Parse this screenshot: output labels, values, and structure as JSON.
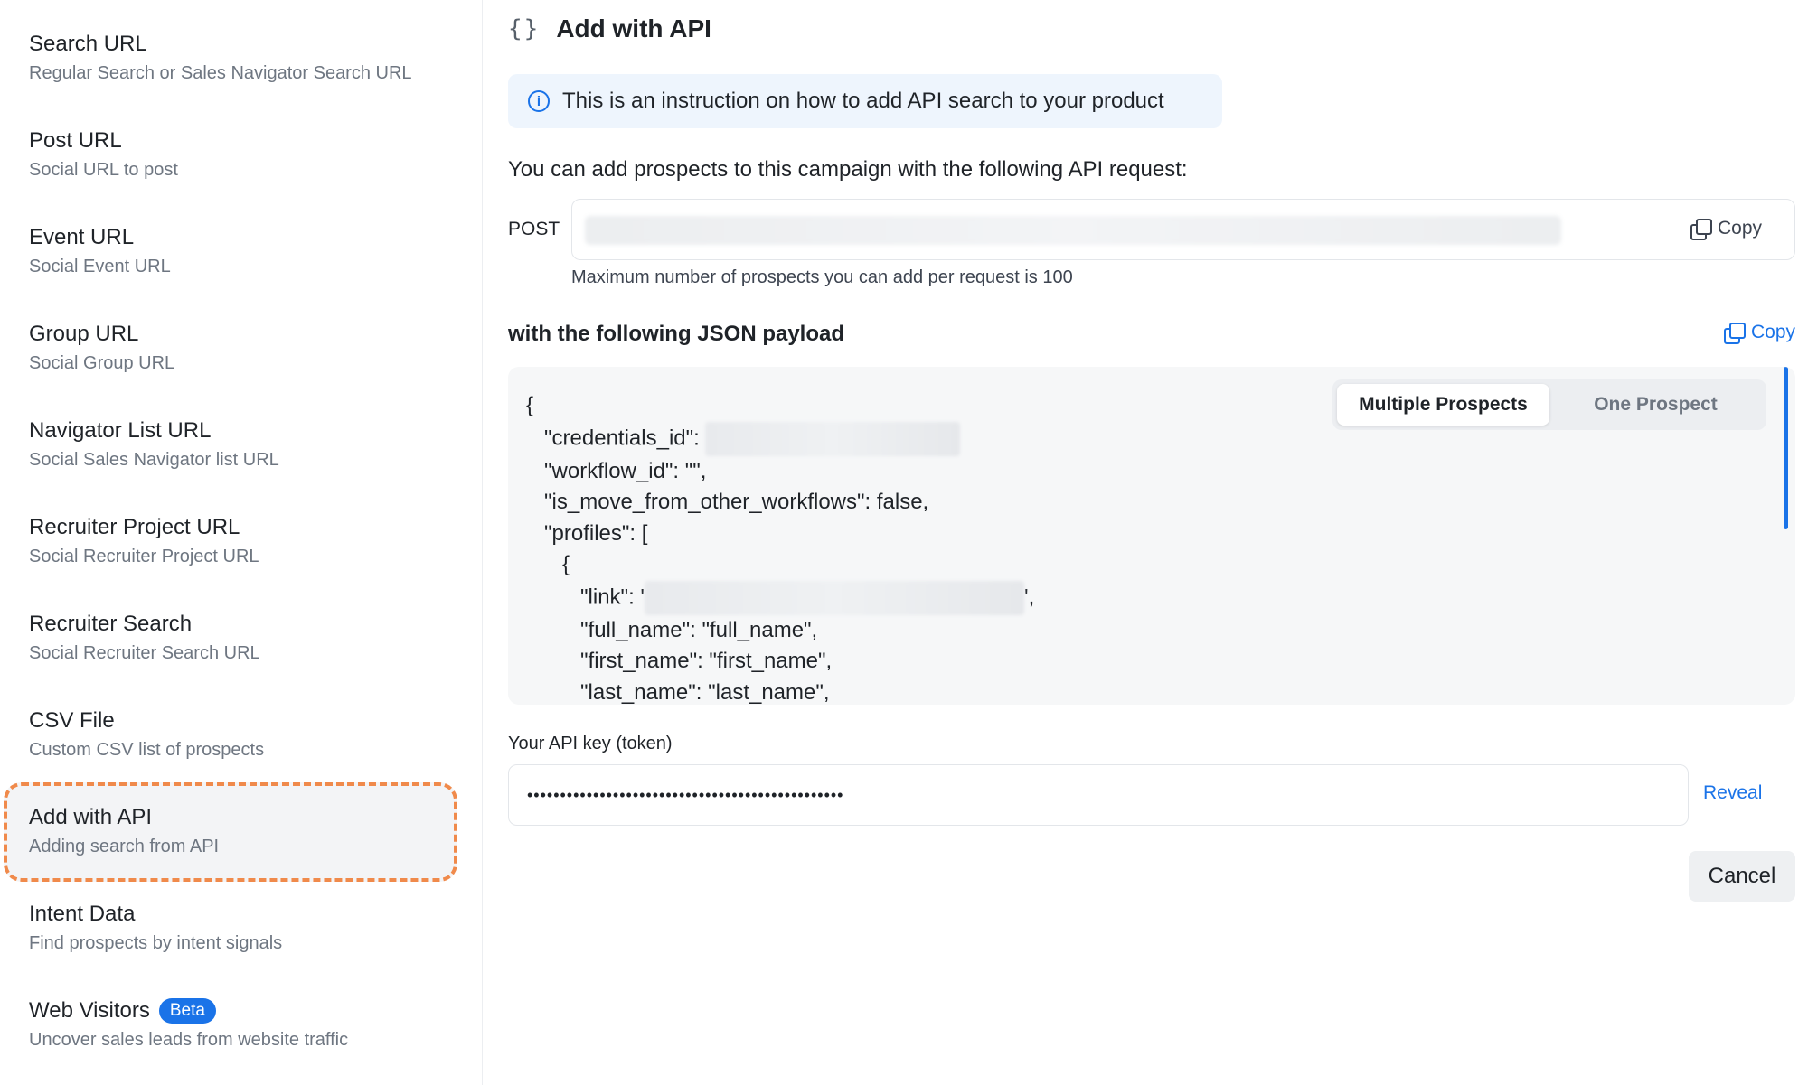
{
  "sidebar": {
    "items": [
      {
        "title": "Search URL",
        "subtitle": "Regular Search or Sales Navigator Search URL"
      },
      {
        "title": "Post URL",
        "subtitle": "Social URL to post"
      },
      {
        "title": "Event URL",
        "subtitle": "Social Event URL"
      },
      {
        "title": "Group URL",
        "subtitle": "Social Group URL"
      },
      {
        "title": "Navigator List URL",
        "subtitle": "Social Sales Navigator list URL"
      },
      {
        "title": "Recruiter Project URL",
        "subtitle": "Social Recruiter Project URL"
      },
      {
        "title": "Recruiter Search",
        "subtitle": "Social Recruiter Search URL"
      },
      {
        "title": "CSV File",
        "subtitle": "Custom CSV list of prospects"
      },
      {
        "title": "Add with API",
        "subtitle": "Adding search from API",
        "selected": true
      },
      {
        "title": "Intent Data",
        "subtitle": "Find prospects by intent signals"
      },
      {
        "title": "Web Visitors",
        "subtitle": "Uncover sales leads from website traffic",
        "badge": "Beta"
      }
    ]
  },
  "header": {
    "icon": "braces-icon",
    "title": "Add with API"
  },
  "info": {
    "icon": "info-icon",
    "text": "This is an instruction on how to add API search to your product"
  },
  "request": {
    "description": "You can add prospects to this campaign with the following API request:",
    "method": "POST",
    "copy_label": "Copy",
    "limit_text": "Maximum number of prospects you can add per request is 100"
  },
  "payload": {
    "title": "with the following JSON payload",
    "copy_label": "Copy",
    "tabs": [
      "Multiple Prospects",
      "One Prospect"
    ],
    "active_tab": 0,
    "lines": {
      "l1": "{",
      "l2": "\"credentials_id\":",
      "l3": "\"workflow_id\": \"\",",
      "l4": "\"is_move_from_other_workflows\": false,",
      "l5": "\"profiles\": [",
      "l6": "{",
      "l7a": "\"link\": '",
      "l7b": "',",
      "l8": "\"full_name\": \"full_name\",",
      "l9": "\"first_name\": \"first_name\",",
      "l10": "\"last_name\": \"last_name\","
    }
  },
  "api_key": {
    "label": "Your API key (token)",
    "value": "••••••••••••••••••••••••••••••••••••••••••••••••",
    "reveal_label": "Reveal"
  },
  "actions": {
    "cancel_label": "Cancel"
  },
  "colors": {
    "accent": "#1a73e8",
    "highlight": "#f08a4b"
  }
}
